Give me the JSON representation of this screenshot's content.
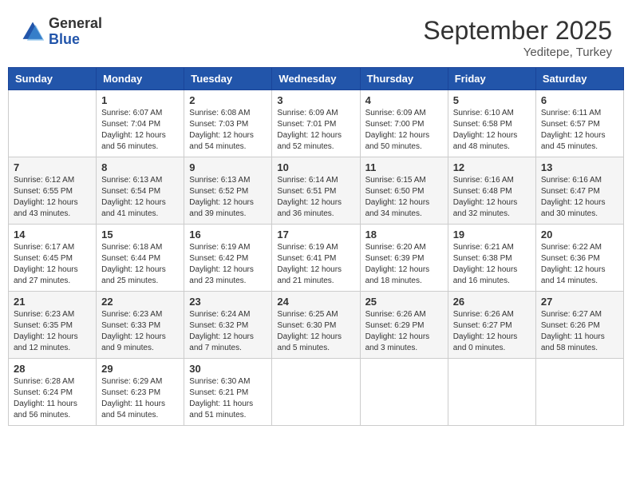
{
  "logo": {
    "text_general": "General",
    "text_blue": "Blue"
  },
  "header": {
    "month": "September 2025",
    "location": "Yeditepe, Turkey"
  },
  "columns": [
    "Sunday",
    "Monday",
    "Tuesday",
    "Wednesday",
    "Thursday",
    "Friday",
    "Saturday"
  ],
  "weeks": [
    [
      {
        "day": "",
        "lines": []
      },
      {
        "day": "1",
        "lines": [
          "Sunrise: 6:07 AM",
          "Sunset: 7:04 PM",
          "Daylight: 12 hours",
          "and 56 minutes."
        ]
      },
      {
        "day": "2",
        "lines": [
          "Sunrise: 6:08 AM",
          "Sunset: 7:03 PM",
          "Daylight: 12 hours",
          "and 54 minutes."
        ]
      },
      {
        "day": "3",
        "lines": [
          "Sunrise: 6:09 AM",
          "Sunset: 7:01 PM",
          "Daylight: 12 hours",
          "and 52 minutes."
        ]
      },
      {
        "day": "4",
        "lines": [
          "Sunrise: 6:09 AM",
          "Sunset: 7:00 PM",
          "Daylight: 12 hours",
          "and 50 minutes."
        ]
      },
      {
        "day": "5",
        "lines": [
          "Sunrise: 6:10 AM",
          "Sunset: 6:58 PM",
          "Daylight: 12 hours",
          "and 48 minutes."
        ]
      },
      {
        "day": "6",
        "lines": [
          "Sunrise: 6:11 AM",
          "Sunset: 6:57 PM",
          "Daylight: 12 hours",
          "and 45 minutes."
        ]
      }
    ],
    [
      {
        "day": "7",
        "lines": [
          "Sunrise: 6:12 AM",
          "Sunset: 6:55 PM",
          "Daylight: 12 hours",
          "and 43 minutes."
        ]
      },
      {
        "day": "8",
        "lines": [
          "Sunrise: 6:13 AM",
          "Sunset: 6:54 PM",
          "Daylight: 12 hours",
          "and 41 minutes."
        ]
      },
      {
        "day": "9",
        "lines": [
          "Sunrise: 6:13 AM",
          "Sunset: 6:52 PM",
          "Daylight: 12 hours",
          "and 39 minutes."
        ]
      },
      {
        "day": "10",
        "lines": [
          "Sunrise: 6:14 AM",
          "Sunset: 6:51 PM",
          "Daylight: 12 hours",
          "and 36 minutes."
        ]
      },
      {
        "day": "11",
        "lines": [
          "Sunrise: 6:15 AM",
          "Sunset: 6:50 PM",
          "Daylight: 12 hours",
          "and 34 minutes."
        ]
      },
      {
        "day": "12",
        "lines": [
          "Sunrise: 6:16 AM",
          "Sunset: 6:48 PM",
          "Daylight: 12 hours",
          "and 32 minutes."
        ]
      },
      {
        "day": "13",
        "lines": [
          "Sunrise: 6:16 AM",
          "Sunset: 6:47 PM",
          "Daylight: 12 hours",
          "and 30 minutes."
        ]
      }
    ],
    [
      {
        "day": "14",
        "lines": [
          "Sunrise: 6:17 AM",
          "Sunset: 6:45 PM",
          "Daylight: 12 hours",
          "and 27 minutes."
        ]
      },
      {
        "day": "15",
        "lines": [
          "Sunrise: 6:18 AM",
          "Sunset: 6:44 PM",
          "Daylight: 12 hours",
          "and 25 minutes."
        ]
      },
      {
        "day": "16",
        "lines": [
          "Sunrise: 6:19 AM",
          "Sunset: 6:42 PM",
          "Daylight: 12 hours",
          "and 23 minutes."
        ]
      },
      {
        "day": "17",
        "lines": [
          "Sunrise: 6:19 AM",
          "Sunset: 6:41 PM",
          "Daylight: 12 hours",
          "and 21 minutes."
        ]
      },
      {
        "day": "18",
        "lines": [
          "Sunrise: 6:20 AM",
          "Sunset: 6:39 PM",
          "Daylight: 12 hours",
          "and 18 minutes."
        ]
      },
      {
        "day": "19",
        "lines": [
          "Sunrise: 6:21 AM",
          "Sunset: 6:38 PM",
          "Daylight: 12 hours",
          "and 16 minutes."
        ]
      },
      {
        "day": "20",
        "lines": [
          "Sunrise: 6:22 AM",
          "Sunset: 6:36 PM",
          "Daylight: 12 hours",
          "and 14 minutes."
        ]
      }
    ],
    [
      {
        "day": "21",
        "lines": [
          "Sunrise: 6:23 AM",
          "Sunset: 6:35 PM",
          "Daylight: 12 hours",
          "and 12 minutes."
        ]
      },
      {
        "day": "22",
        "lines": [
          "Sunrise: 6:23 AM",
          "Sunset: 6:33 PM",
          "Daylight: 12 hours",
          "and 9 minutes."
        ]
      },
      {
        "day": "23",
        "lines": [
          "Sunrise: 6:24 AM",
          "Sunset: 6:32 PM",
          "Daylight: 12 hours",
          "and 7 minutes."
        ]
      },
      {
        "day": "24",
        "lines": [
          "Sunrise: 6:25 AM",
          "Sunset: 6:30 PM",
          "Daylight: 12 hours",
          "and 5 minutes."
        ]
      },
      {
        "day": "25",
        "lines": [
          "Sunrise: 6:26 AM",
          "Sunset: 6:29 PM",
          "Daylight: 12 hours",
          "and 3 minutes."
        ]
      },
      {
        "day": "26",
        "lines": [
          "Sunrise: 6:26 AM",
          "Sunset: 6:27 PM",
          "Daylight: 12 hours",
          "and 0 minutes."
        ]
      },
      {
        "day": "27",
        "lines": [
          "Sunrise: 6:27 AM",
          "Sunset: 6:26 PM",
          "Daylight: 11 hours",
          "and 58 minutes."
        ]
      }
    ],
    [
      {
        "day": "28",
        "lines": [
          "Sunrise: 6:28 AM",
          "Sunset: 6:24 PM",
          "Daylight: 11 hours",
          "and 56 minutes."
        ]
      },
      {
        "day": "29",
        "lines": [
          "Sunrise: 6:29 AM",
          "Sunset: 6:23 PM",
          "Daylight: 11 hours",
          "and 54 minutes."
        ]
      },
      {
        "day": "30",
        "lines": [
          "Sunrise: 6:30 AM",
          "Sunset: 6:21 PM",
          "Daylight: 11 hours",
          "and 51 minutes."
        ]
      },
      {
        "day": "",
        "lines": []
      },
      {
        "day": "",
        "lines": []
      },
      {
        "day": "",
        "lines": []
      },
      {
        "day": "",
        "lines": []
      }
    ]
  ]
}
